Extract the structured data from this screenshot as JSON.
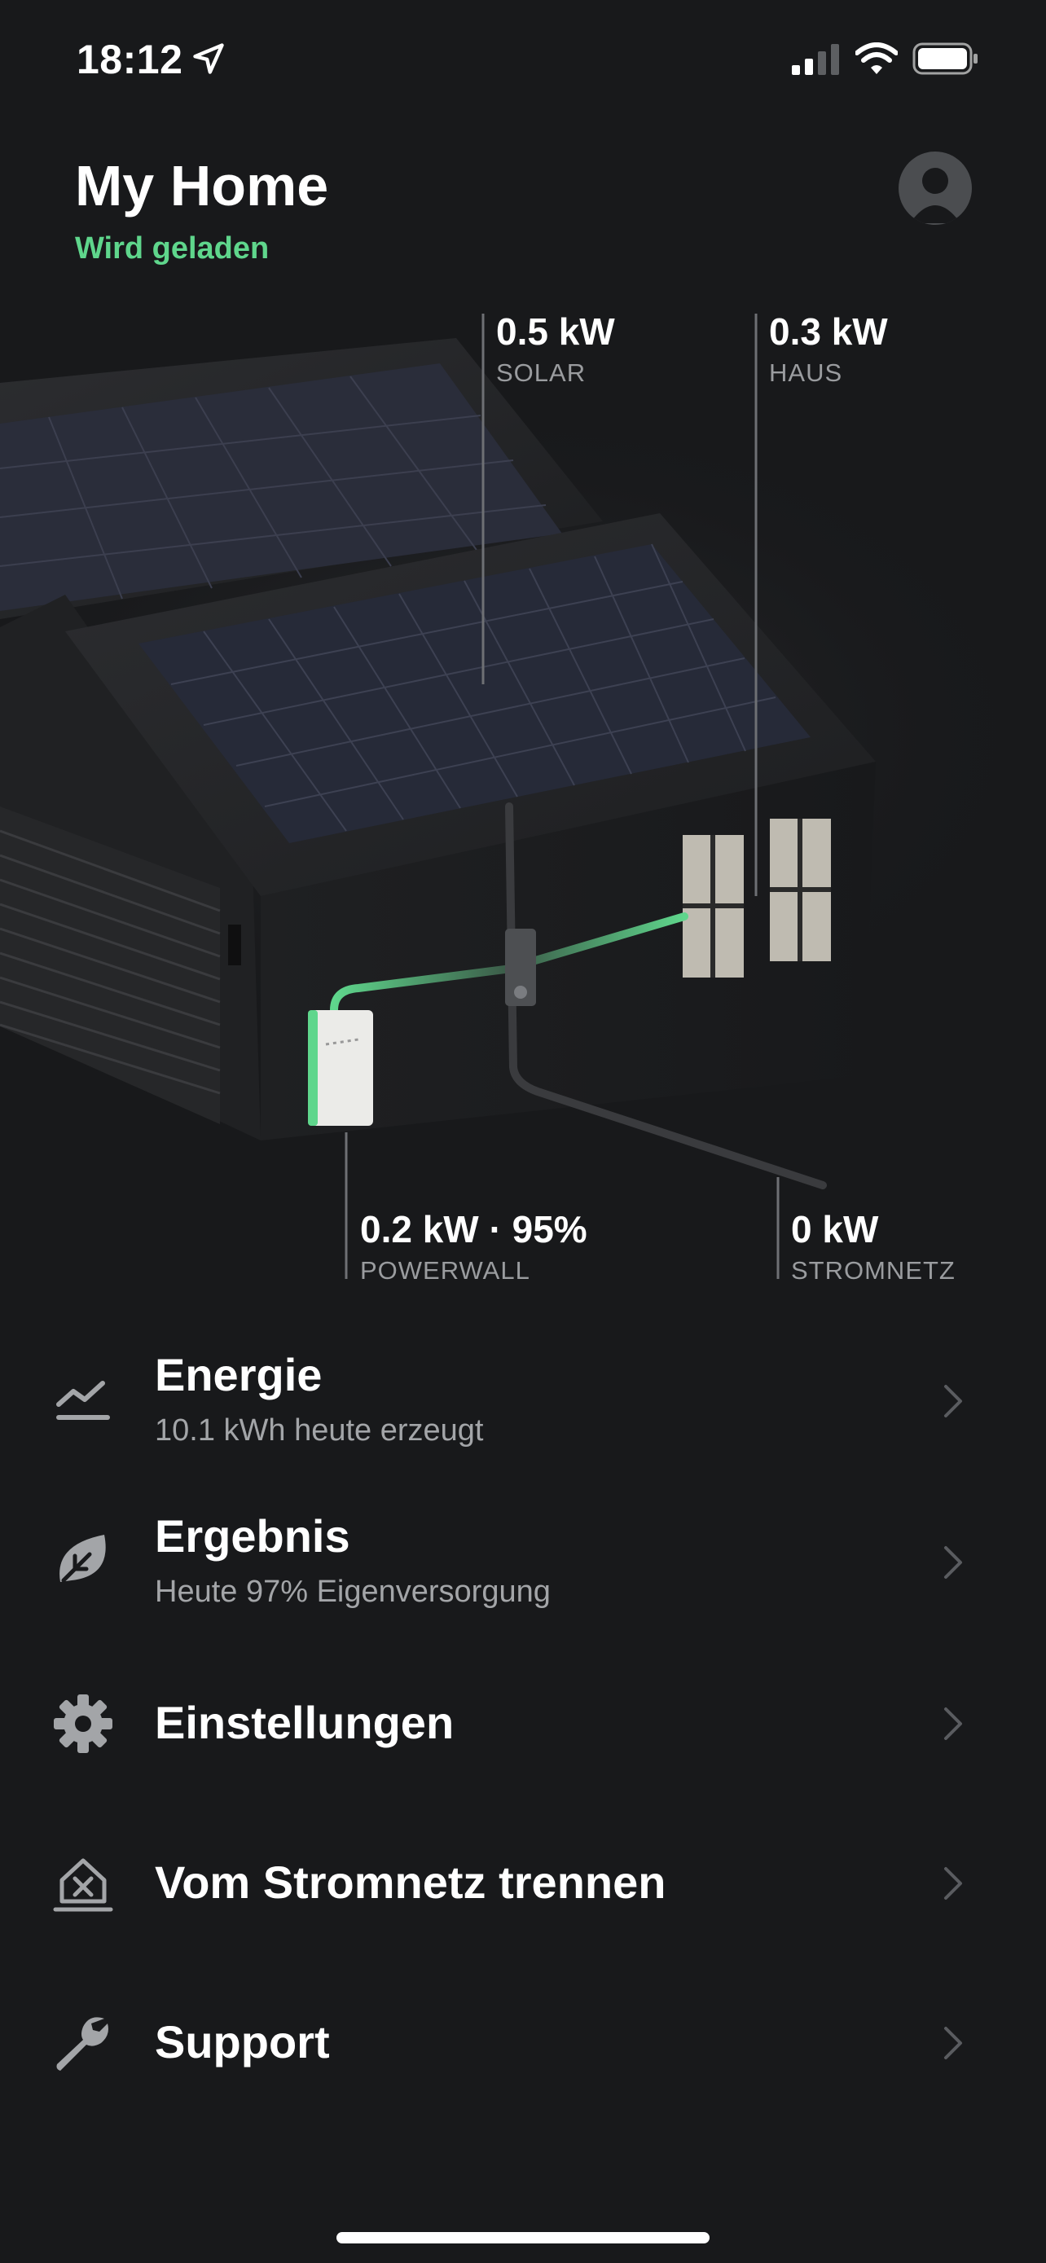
{
  "status_bar": {
    "time": "18:12",
    "icons": [
      "location-arrow-icon",
      "cellular-signal-icon",
      "wifi-icon",
      "battery-icon"
    ]
  },
  "header": {
    "title": "My Home",
    "status": "Wird geladen",
    "status_color": "#5fd68c",
    "avatar_icon": "person-icon"
  },
  "energy_flow": {
    "solar": {
      "value": "0.5 kW",
      "label": "SOLAR"
    },
    "home": {
      "value": "0.3 kW",
      "label": "HAUS"
    },
    "powerwall": {
      "value": "0.2 kW · 95%",
      "label": "POWERWALL"
    },
    "grid": {
      "value": "0 kW",
      "label": "STROMNETZ"
    }
  },
  "menu": [
    {
      "title": "Energie",
      "subtitle": "10.1 kWh heute erzeugt",
      "icon": "energy-chart-icon"
    },
    {
      "title": "Ergebnis",
      "subtitle": "Heute 97% Eigenversorgung",
      "icon": "leaf-icon"
    },
    {
      "title": "Einstellungen",
      "subtitle": "",
      "icon": "gear-icon"
    },
    {
      "title": "Vom Stromnetz trennen",
      "subtitle": "",
      "icon": "off-grid-house-icon"
    },
    {
      "title": "Support",
      "subtitle": "",
      "icon": "wrench-icon"
    }
  ],
  "colors": {
    "background": "#18191b",
    "accent_green": "#5fd68c",
    "secondary_text": "#a3a5a8"
  }
}
